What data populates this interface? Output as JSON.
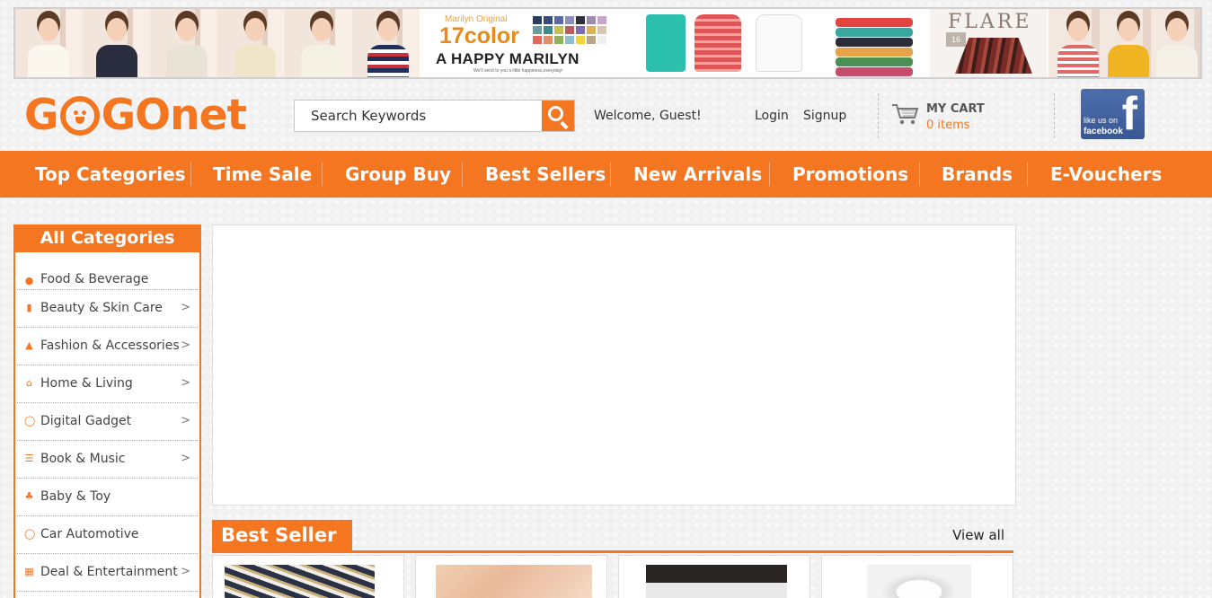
{
  "banner": {
    "promo_small": "Marilyn Original",
    "promo_big": "17color",
    "promo_title": "A HAPPY MARILYN",
    "promo_sub": "We'll send to you a little happiness,everyday!",
    "flare_word": "FLARE",
    "flare_tag": "16"
  },
  "header": {
    "logo_left": "G",
    "logo_right": "GOnet",
    "search_placeholder": "Search Keywords",
    "welcome": "Welcome, Guest!",
    "login": "Login",
    "signup": "Signup",
    "cart_title": "MY CART",
    "cart_count": "0 items",
    "fb_like": "like us on",
    "fb_name": "facebook",
    "fb_f": "f"
  },
  "nav": [
    {
      "label": "Top Categories"
    },
    {
      "label": "Time Sale"
    },
    {
      "label": "Group Buy"
    },
    {
      "label": "Best Sellers"
    },
    {
      "label": "New Arrivals"
    },
    {
      "label": "Promotions"
    },
    {
      "label": "Brands"
    },
    {
      "label": "E-Vouchers"
    }
  ],
  "sidebar": {
    "title": "All Categories",
    "items": [
      {
        "label": "Food & Beverage",
        "icon": "food-icon",
        "arrow": ""
      },
      {
        "label": "Beauty & Skin Care",
        "icon": "beauty-icon",
        "arrow": ">"
      },
      {
        "label": "Fashion & Accessories",
        "icon": "fashion-icon",
        "arrow": ">"
      },
      {
        "label": "Home & Living",
        "icon": "home-icon",
        "arrow": ">"
      },
      {
        "label": "Digital Gadget",
        "icon": "gadget-icon",
        "arrow": ">"
      },
      {
        "label": "Book & Music",
        "icon": "book-icon",
        "arrow": ">"
      },
      {
        "label": "Baby & Toy",
        "icon": "baby-icon",
        "arrow": ""
      },
      {
        "label": "Car Automotive",
        "icon": "car-icon",
        "arrow": ""
      },
      {
        "label": "Deal & Entertainment",
        "icon": "deal-icon",
        "arrow": ">"
      }
    ]
  },
  "best_seller": {
    "title": "Best Seller",
    "view_all": "View all"
  },
  "colors": {
    "accent": "#f47621",
    "facebook": "#3a5795"
  }
}
